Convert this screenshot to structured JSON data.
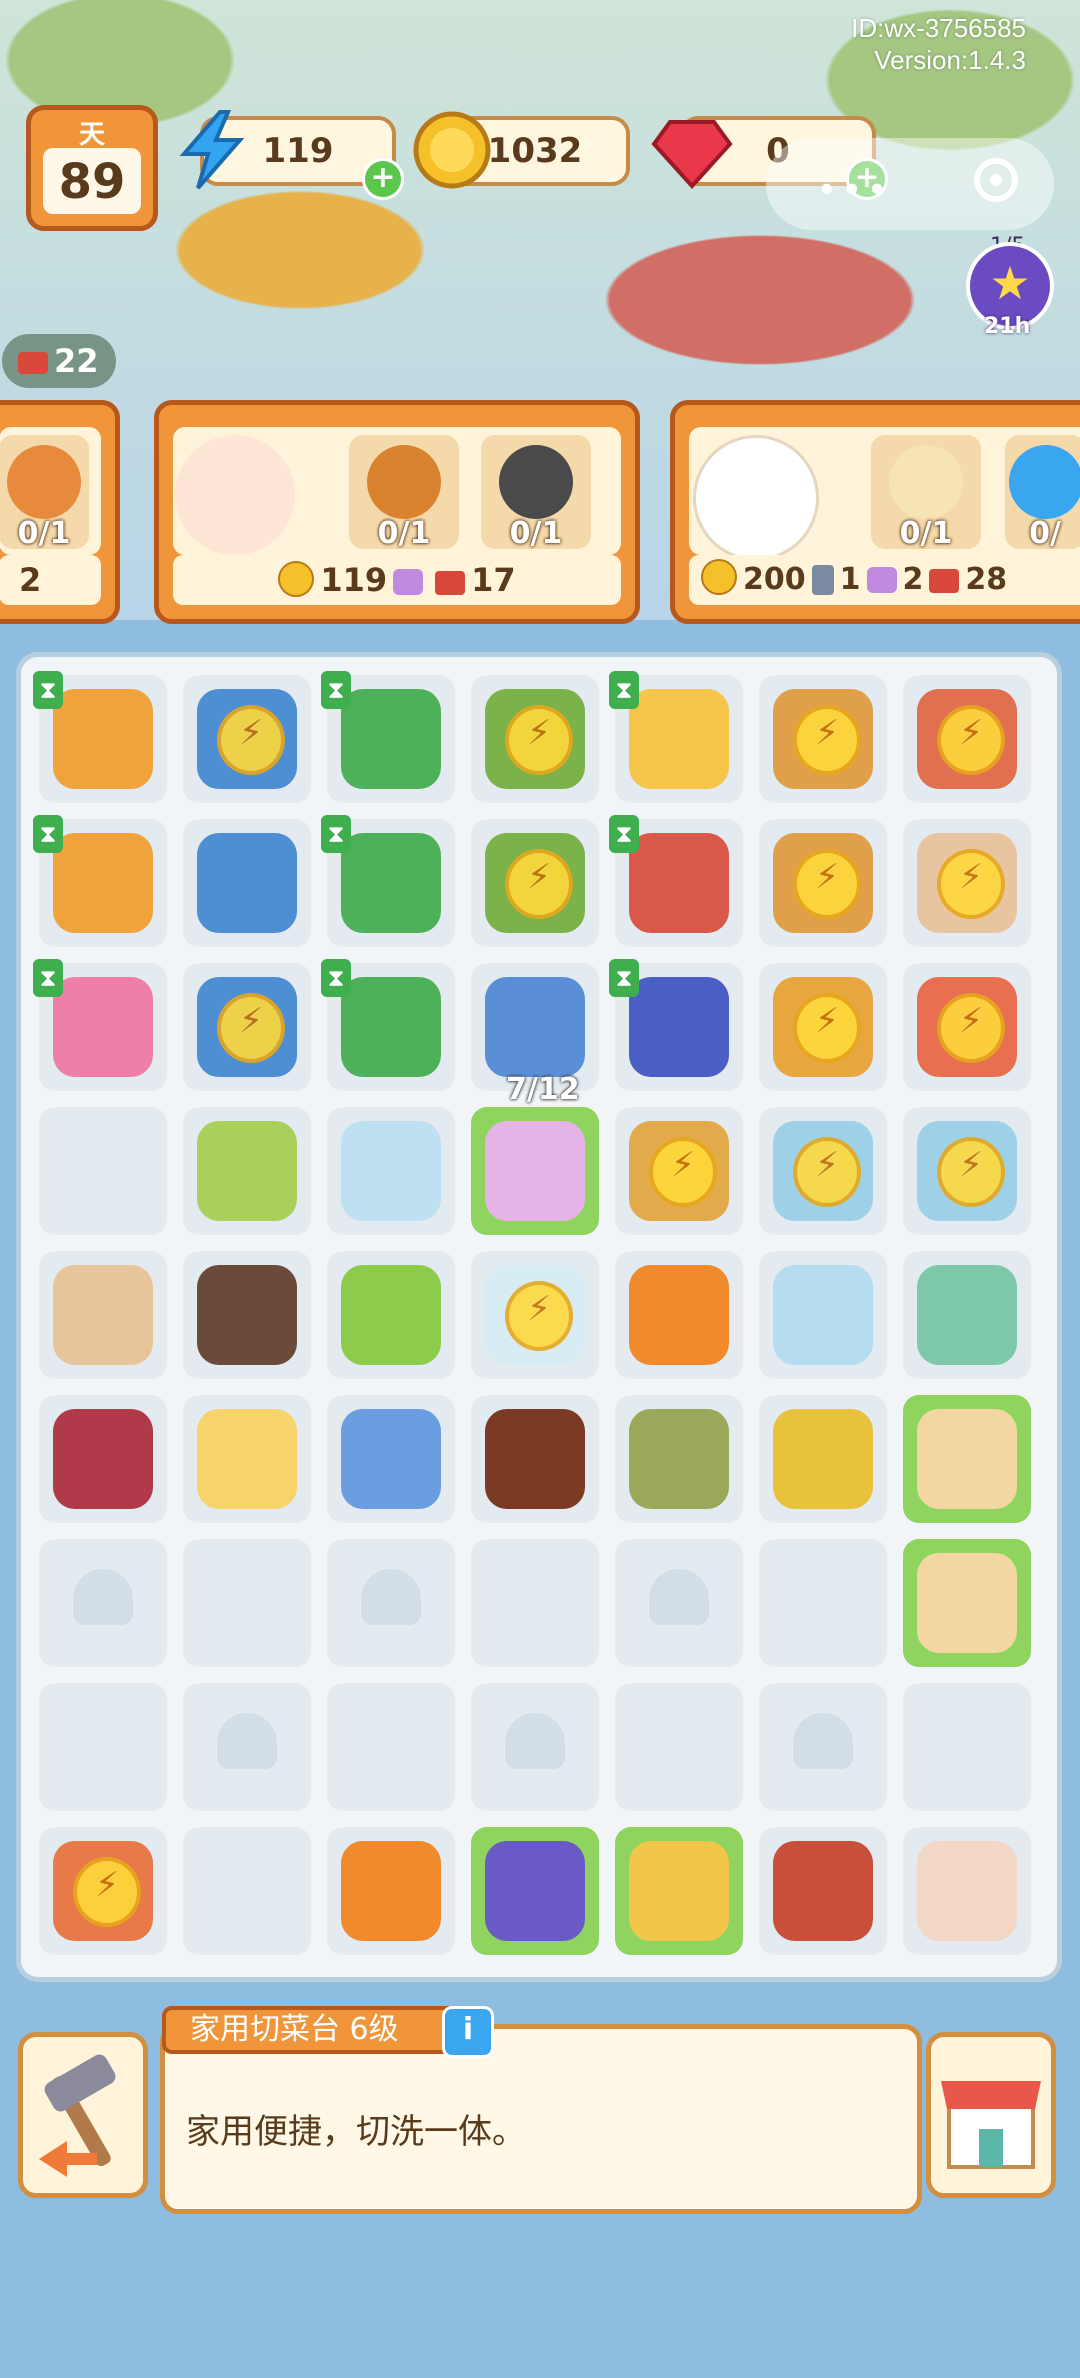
{
  "header": {
    "id_text": "ID:wx-3756585",
    "version_text": "Version:1.4.3",
    "day_label": "天",
    "day_value": "89",
    "energy": "119",
    "coins": "1032",
    "gems": "0",
    "star_progress": "1/5",
    "star_timer": "21h",
    "tickets": "22"
  },
  "orders": [
    {
      "slots": [
        "0/1"
      ],
      "footer": "2"
    },
    {
      "character_count": "1",
      "slots": [
        "0/1",
        "0/1"
      ],
      "coins": "119",
      "gems": "",
      "tickets": "17"
    },
    {
      "character_count": "1",
      "slots": [
        "0/1",
        "0/"
      ],
      "coins": "200",
      "cards": "1",
      "gems": "2",
      "tickets": "28"
    }
  ],
  "board": {
    "progress_label": "7/12"
  },
  "selected_item": {
    "name": "家用切菜台 6级",
    "description": "家用便捷，切洗一体。",
    "info_icon": "i"
  },
  "colors": {
    "accent_orange": "#f0953a",
    "highlight_green": "#8fd45e",
    "board_bg": "#f2f5f7"
  }
}
